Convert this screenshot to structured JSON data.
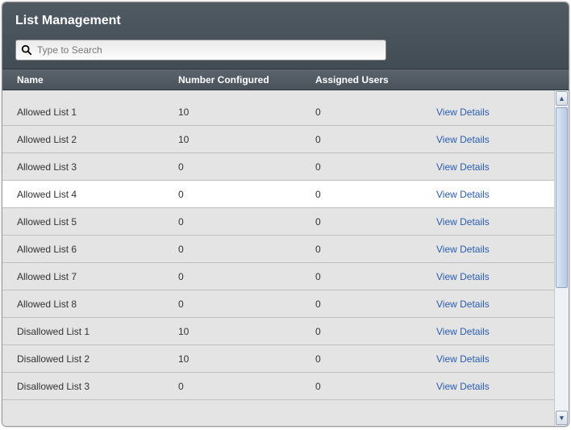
{
  "title": "List Management",
  "search": {
    "placeholder": "Type to Search",
    "value": ""
  },
  "columns": {
    "name": "Name",
    "numberConfigured": "Number Configured",
    "assignedUsers": "Assigned Users"
  },
  "viewLabel": "View Details",
  "rows": [
    {
      "name": "Allowed List 1",
      "num": "10",
      "users": "0",
      "hover": false
    },
    {
      "name": "Allowed List 2",
      "num": "10",
      "users": "0",
      "hover": false
    },
    {
      "name": "Allowed List 3",
      "num": "0",
      "users": "0",
      "hover": false
    },
    {
      "name": "Allowed List 4",
      "num": "0",
      "users": "0",
      "hover": true
    },
    {
      "name": "Allowed List 5",
      "num": "0",
      "users": "0",
      "hover": false
    },
    {
      "name": "Allowed List 6",
      "num": "0",
      "users": "0",
      "hover": false
    },
    {
      "name": "Allowed List 7",
      "num": "0",
      "users": "0",
      "hover": false
    },
    {
      "name": "Allowed List 8",
      "num": "0",
      "users": "0",
      "hover": false
    },
    {
      "name": "Disallowed List 1",
      "num": "10",
      "users": "0",
      "hover": false
    },
    {
      "name": "Disallowed List 2",
      "num": "10",
      "users": "0",
      "hover": false
    },
    {
      "name": "Disallowed List 3",
      "num": "0",
      "users": "0",
      "hover": false
    }
  ]
}
